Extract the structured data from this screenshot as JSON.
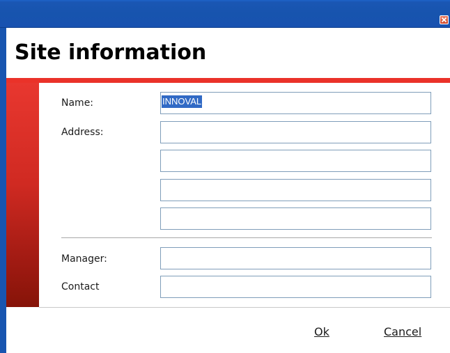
{
  "window": {
    "close_icon": "close-icon"
  },
  "header": {
    "title": "Site information"
  },
  "form": {
    "name_label": "Name:",
    "name_value": "INNOVAL",
    "address_label": "Address:",
    "address_lines": [
      "",
      "",
      "",
      ""
    ],
    "manager_label": "Manager:",
    "manager_value": "",
    "contact_label": "Contact",
    "contact_value": ""
  },
  "footer": {
    "ok_label": "Ok",
    "cancel_label": "Cancel"
  },
  "colors": {
    "titlebar": "#1754ae",
    "accent": "#ea3229",
    "strip_dark": "#861408",
    "selection": "#316ac5",
    "field_border": "#7f9db9"
  }
}
